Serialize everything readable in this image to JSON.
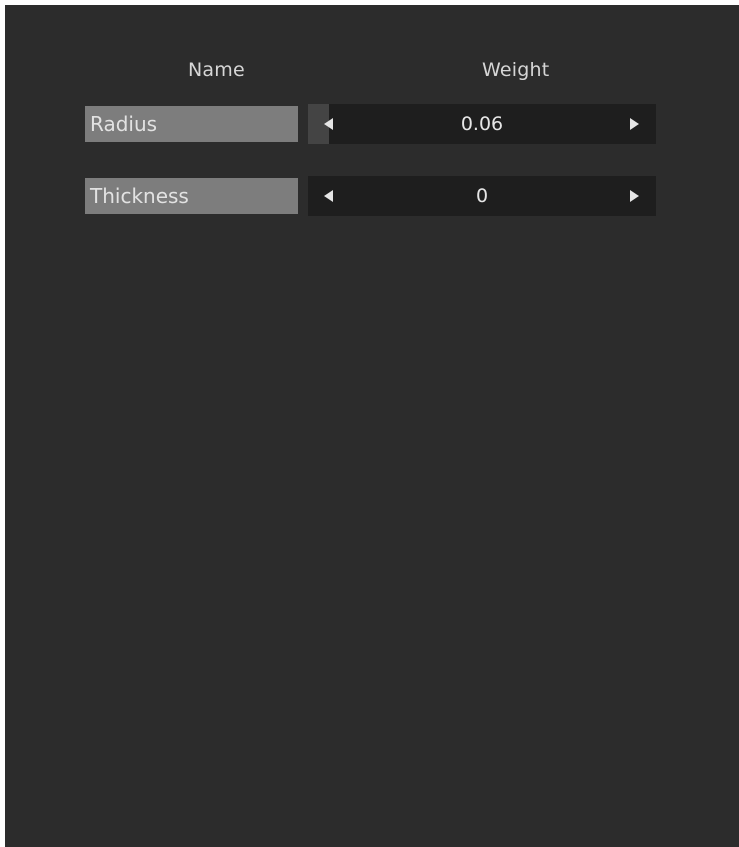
{
  "table": {
    "headers": {
      "name": "Name",
      "weight": "Weight"
    },
    "rows": [
      {
        "name": "Radius",
        "value": "0.06",
        "fill_fraction": 0.06
      },
      {
        "name": "Thickness",
        "value": "0",
        "fill_fraction": 0
      }
    ]
  },
  "colors": {
    "panel_background": "#2c2c2c",
    "name_field_background": "#7d7d7d",
    "stepper_background": "#1e1e1e",
    "stepper_fill": "#444444",
    "text": "#e6e6e6"
  },
  "icons": {
    "decrement": "triangle-left-icon",
    "increment": "triangle-right-icon"
  }
}
